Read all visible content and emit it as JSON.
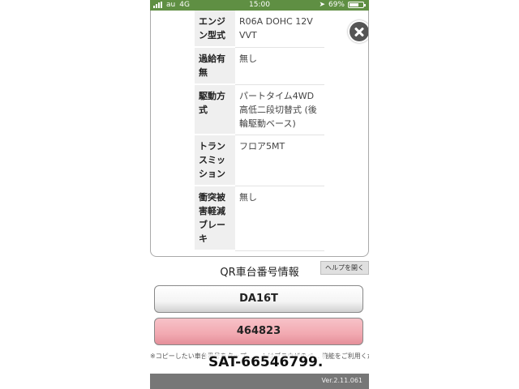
{
  "status_bar": {
    "carrier": "au",
    "network": "4G",
    "time": "15:00",
    "location_icon": "location-arrow-icon",
    "battery_percent": "69%",
    "battery_level": 0.69
  },
  "spec_table": {
    "rows": [
      {
        "label": "エンジン型式",
        "value": "R06A DOHC 12V VVT"
      },
      {
        "label": "過給有無",
        "value": "無し"
      },
      {
        "label": "駆動方式",
        "value": "パートタイム4WD 高低二段切替式 (後輪駆動ベース)"
      },
      {
        "label": "トランスミッション",
        "value": "フロア5MT"
      },
      {
        "label": "衝突被害軽減ブレーキ",
        "value": "無し"
      }
    ]
  },
  "close_icon": "close-icon",
  "qr": {
    "title": "QR車台番号情報",
    "help_label": "ヘルプを開く",
    "model_code": "DA16T",
    "serial_number": "464823"
  },
  "note": {
    "text": "※コピーしたい車台番号をタップ… …トはブラウザのペ… 機能をご利用ください。"
  },
  "overlay": {
    "text": "SAT-66546799."
  },
  "footer": {
    "version": "Ver.2.11.061"
  },
  "colors": {
    "status_bar": "#5f8f43",
    "serial_button": "#f2a9b1",
    "model_button": "#f4f4f4"
  }
}
